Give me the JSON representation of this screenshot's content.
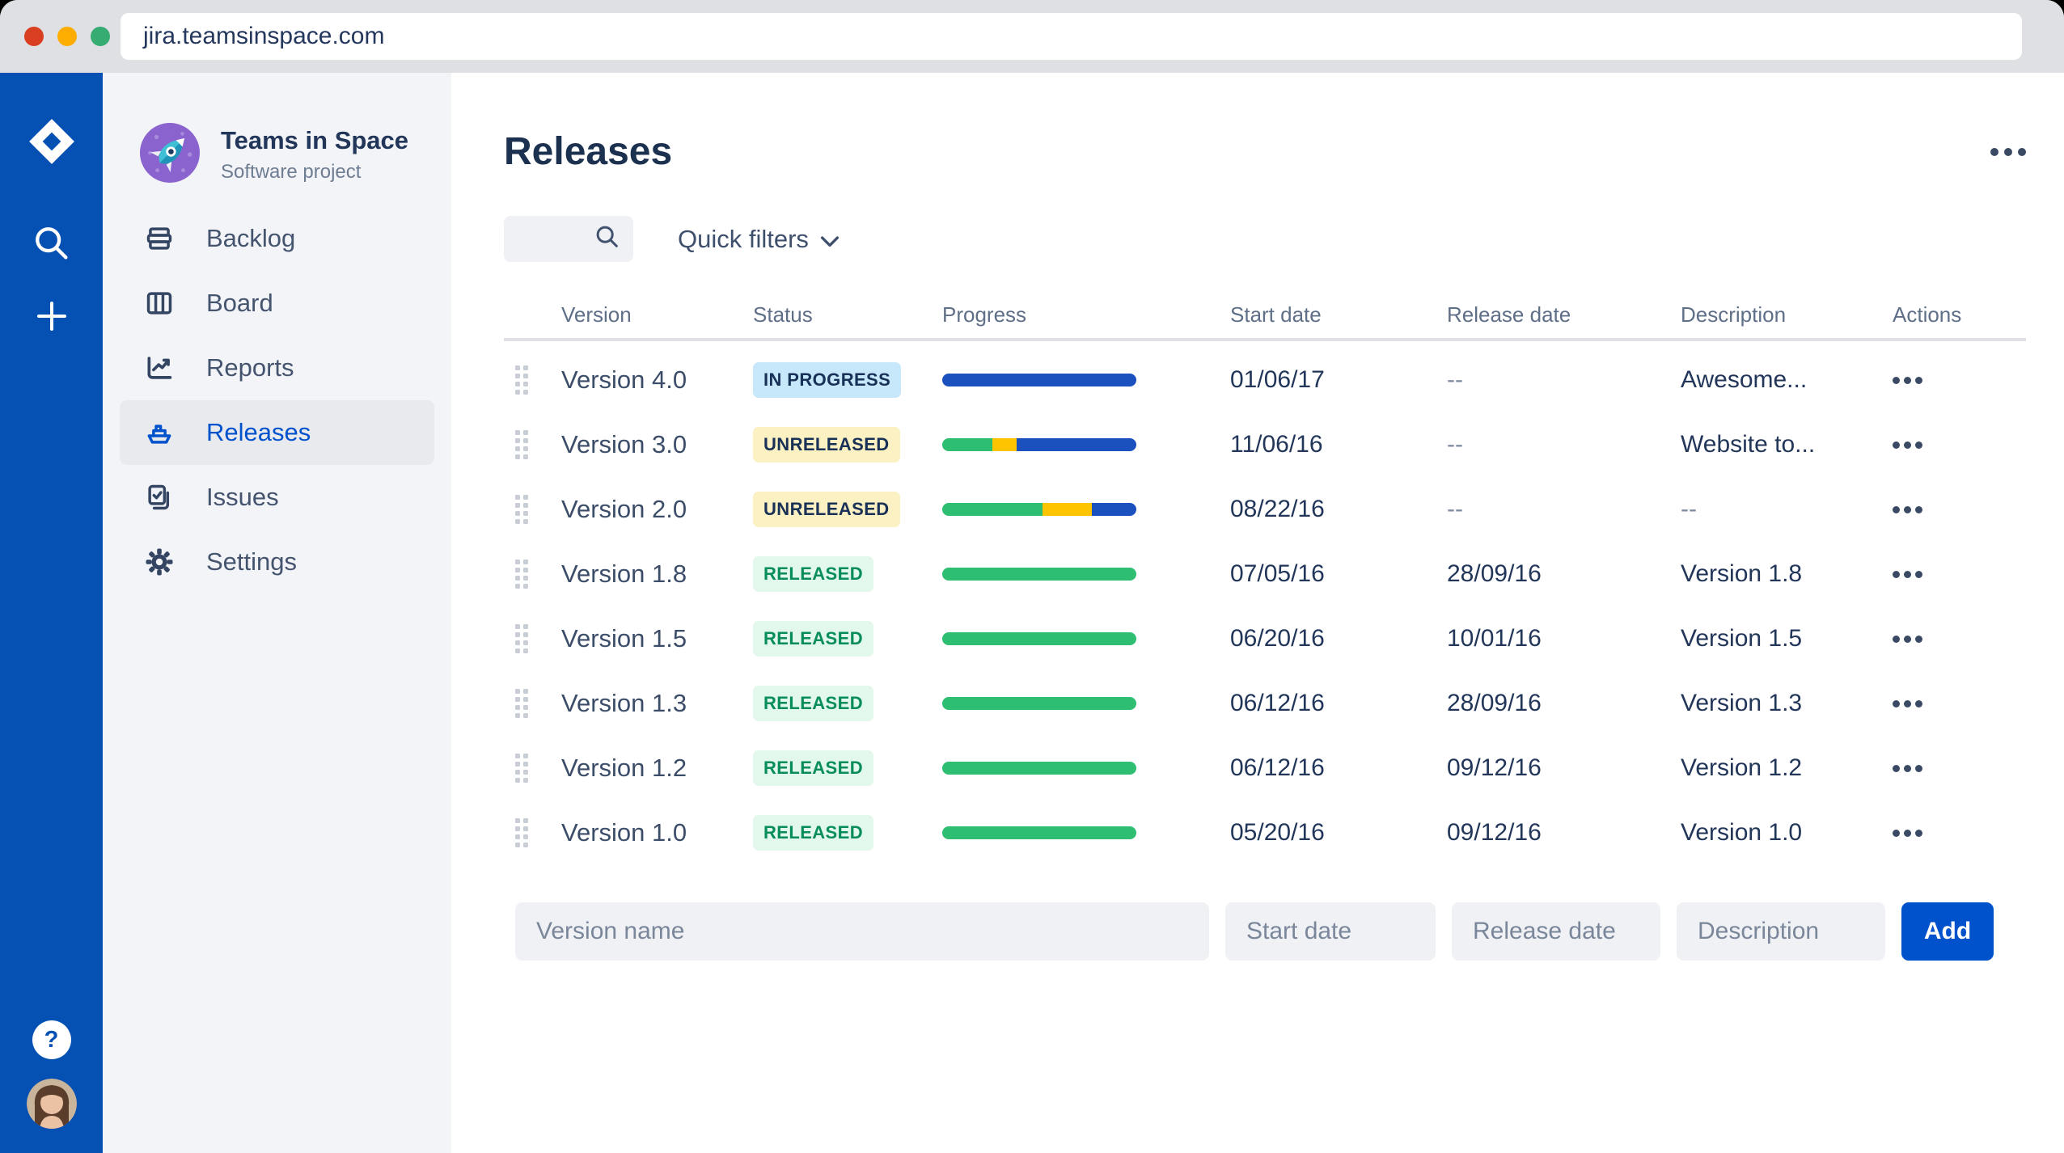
{
  "browser": {
    "url": "jira.teamsinspace.com"
  },
  "project": {
    "name": "Teams in Space",
    "type": "Software project",
    "nav": [
      {
        "label": "Backlog"
      },
      {
        "label": "Board"
      },
      {
        "label": "Reports"
      },
      {
        "label": "Releases",
        "selected": true
      },
      {
        "label": "Issues"
      },
      {
        "label": "Settings"
      }
    ]
  },
  "page": {
    "title": "Releases"
  },
  "filters": {
    "quick_filters_label": "Quick filters",
    "search_value": ""
  },
  "table": {
    "columns": [
      "Version",
      "Status",
      "Progress",
      "Start date",
      "Release date",
      "Description",
      "Actions"
    ],
    "rows": [
      {
        "version": "Version 4.0",
        "status": "IN PROGRESS",
        "status_type": "in-progress",
        "progress": [
          {
            "color": "blue",
            "pct": 100
          }
        ],
        "start_date": "01/06/17",
        "release_date": "--",
        "description": "Awesome..."
      },
      {
        "version": "Version 3.0",
        "status": "UNRELEASED",
        "status_type": "unreleased",
        "progress": [
          {
            "color": "green",
            "pct": 26
          },
          {
            "color": "yellow",
            "pct": 12.5
          },
          {
            "color": "blue",
            "pct": 61.5
          }
        ],
        "start_date": "11/06/16",
        "release_date": "--",
        "description": "Website to..."
      },
      {
        "version": "Version 2.0",
        "status": "UNRELEASED",
        "status_type": "unreleased",
        "progress": [
          {
            "color": "green",
            "pct": 51.5
          },
          {
            "color": "yellow",
            "pct": 25.5
          },
          {
            "color": "blue",
            "pct": 23
          }
        ],
        "start_date": "08/22/16",
        "release_date": "--",
        "description": "--"
      },
      {
        "version": "Version 1.8",
        "status": "RELEASED",
        "status_type": "released",
        "progress": [
          {
            "color": "green",
            "pct": 100
          }
        ],
        "start_date": "07/05/16",
        "release_date": "28/09/16",
        "description": "Version 1.8"
      },
      {
        "version": "Version 1.5",
        "status": "RELEASED",
        "status_type": "released",
        "progress": [
          {
            "color": "green",
            "pct": 100
          }
        ],
        "start_date": "06/20/16",
        "release_date": "10/01/16",
        "description": "Version 1.5"
      },
      {
        "version": "Version 1.3",
        "status": "RELEASED",
        "status_type": "released",
        "progress": [
          {
            "color": "green",
            "pct": 100
          }
        ],
        "start_date": "06/12/16",
        "release_date": "28/09/16",
        "description": "Version 1.3"
      },
      {
        "version": "Version 1.2",
        "status": "RELEASED",
        "status_type": "released",
        "progress": [
          {
            "color": "green",
            "pct": 100
          }
        ],
        "start_date": "06/12/16",
        "release_date": "09/12/16",
        "description": "Version 1.2"
      },
      {
        "version": "Version 1.0",
        "status": "RELEASED",
        "status_type": "released",
        "progress": [
          {
            "color": "green",
            "pct": 100
          }
        ],
        "start_date": "05/20/16",
        "release_date": "09/12/16",
        "description": "Version 1.0"
      }
    ]
  },
  "form": {
    "version_name_placeholder": "Version name",
    "start_date_placeholder": "Start date",
    "release_date_placeholder": "Release date",
    "description_placeholder": "Description",
    "add_label": "Add"
  },
  "help_label": "?",
  "colors": {
    "blue": "#1B51BE",
    "green": "#2DBE71",
    "yellow": "#FFC400",
    "sidebar_blue": "#0550B3",
    "accent_blue": "#0052CC"
  }
}
